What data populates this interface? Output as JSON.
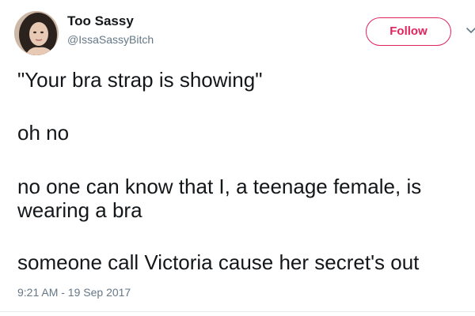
{
  "user": {
    "display_name": "Too Sassy",
    "handle": "@IssaSassyBitch",
    "avatar_icon": "profile-photo"
  },
  "actions": {
    "follow_label": "Follow",
    "follow_color": "#e0245e",
    "more_icon": "chevron-down-icon"
  },
  "tweet": {
    "lines": [
      "\"Your bra strap is showing\"",
      "oh no",
      "no one can know that I, a teenage female, is",
      "wearing a bra",
      "someone call Victoria cause her secret's out"
    ],
    "timestamp": "9:21 AM - 19 Sep 2017"
  }
}
